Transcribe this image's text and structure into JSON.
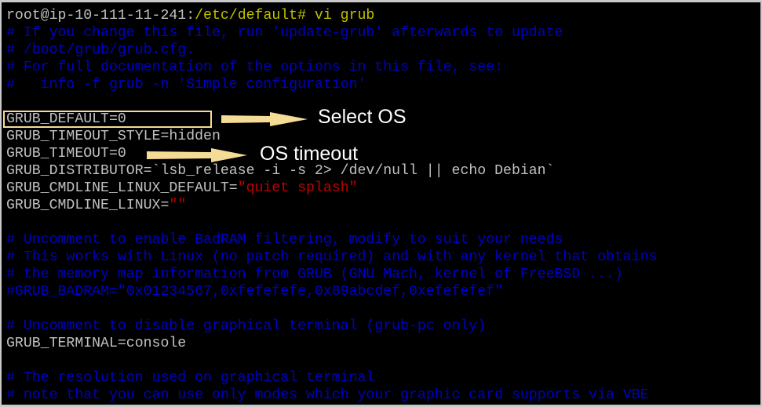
{
  "terminal": {
    "lines": [
      {
        "segments": [
          {
            "text": "root@ip-10-111-11-241:",
            "color": "white"
          },
          {
            "text": "/etc/default# vi grub",
            "color": "yellow"
          }
        ]
      },
      {
        "segments": [
          {
            "text": "# If you change this file, run 'update-grub' afterwards to update",
            "color": "blue"
          }
        ]
      },
      {
        "segments": [
          {
            "text": "# /boot/grub/grub.cfg.",
            "color": "blue"
          }
        ]
      },
      {
        "segments": [
          {
            "text": "# For full documentation of the options in this file, see:",
            "color": "blue"
          }
        ]
      },
      {
        "segments": [
          {
            "text": "#   info -f grub -n 'Simple configuration'",
            "color": "blue"
          }
        ]
      },
      {
        "segments": [
          {
            "text": "",
            "color": "white"
          }
        ]
      },
      {
        "segments": [
          {
            "text": "GRUB_DEFAULT=0",
            "color": "white"
          }
        ]
      },
      {
        "segments": [
          {
            "text": "GRUB_TIMEOUT_STYLE=hidden",
            "color": "white"
          }
        ]
      },
      {
        "segments": [
          {
            "text": "GRUB_TIMEOUT=0",
            "color": "white"
          }
        ]
      },
      {
        "segments": [
          {
            "text": "GRUB_DISTRIBUTOR=`lsb_release -i -s 2> /dev/null || echo Debian`",
            "color": "white"
          }
        ]
      },
      {
        "segments": [
          {
            "text": "GRUB_CMDLINE_LINUX_DEFAULT=",
            "color": "white"
          },
          {
            "text": "\"quiet splash\"",
            "color": "red"
          }
        ]
      },
      {
        "segments": [
          {
            "text": "GRUB_CMDLINE_LINUX=",
            "color": "white"
          },
          {
            "text": "\"\"",
            "color": "red"
          }
        ]
      },
      {
        "segments": [
          {
            "text": "",
            "color": "white"
          }
        ]
      },
      {
        "segments": [
          {
            "text": "# Uncomment to enable BadRAM filtering, modify to suit your needs",
            "color": "blue"
          }
        ]
      },
      {
        "segments": [
          {
            "text": "# This works with Linux (no patch required) and with any kernel that obtains",
            "color": "blue"
          }
        ]
      },
      {
        "segments": [
          {
            "text": "# the memory map information from GRUB (GNU Mach, kernel of FreeBSD ...)",
            "color": "blue"
          }
        ]
      },
      {
        "segments": [
          {
            "text": "#GRUB_BADRAM=\"0x01234567,0xfefefefe,0x89abcdef,0xefefefef\"",
            "color": "blue"
          }
        ]
      },
      {
        "segments": [
          {
            "text": "",
            "color": "white"
          }
        ]
      },
      {
        "segments": [
          {
            "text": "# Uncomment to disable graphical terminal (grub-pc only)",
            "color": "blue"
          }
        ]
      },
      {
        "segments": [
          {
            "text": "GRUB_TERMINAL=console",
            "color": "white"
          }
        ]
      },
      {
        "segments": [
          {
            "text": "",
            "color": "white"
          }
        ]
      },
      {
        "segments": [
          {
            "text": "# The resolution used on graphical terminal",
            "color": "blue"
          }
        ]
      },
      {
        "segments": [
          {
            "text": "# note that you can use only modes which your graphic card supports via VBE",
            "color": "blue"
          }
        ]
      }
    ]
  },
  "annotations": {
    "select_os_label": "Select OS",
    "os_timeout_label": "OS timeout",
    "accent_color": "#f5dc96"
  }
}
